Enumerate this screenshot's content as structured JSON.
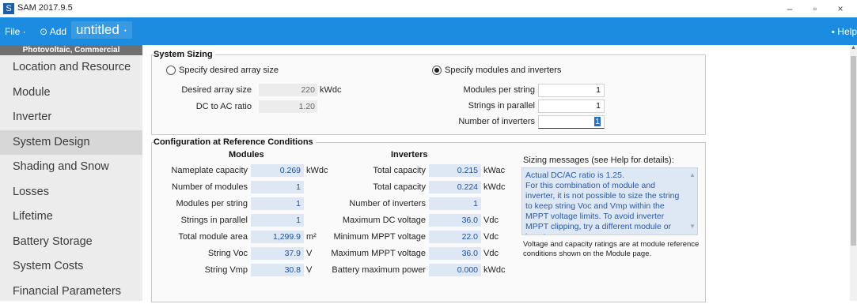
{
  "app": {
    "title": "SAM 2017.9.5",
    "icon": "S",
    "window_controls": [
      "–",
      "▫",
      "×"
    ]
  },
  "menu": {
    "file": "File ·",
    "add": "⊙ Add",
    "project": "untitled ·",
    "help": "▪ Help"
  },
  "sidebar": {
    "header": "Photovoltaic, Commercial",
    "items": [
      {
        "label": "Location and Resource"
      },
      {
        "label": "Module"
      },
      {
        "label": "Inverter"
      },
      {
        "label": "System Design"
      },
      {
        "label": "Shading and Snow"
      },
      {
        "label": "Losses"
      },
      {
        "label": "Lifetime"
      },
      {
        "label": "Battery Storage"
      },
      {
        "label": "System Costs"
      },
      {
        "label": "Financial Parameters"
      }
    ],
    "active_index": 3
  },
  "sizing": {
    "title": "System Sizing",
    "option_array": "Specify desired array size",
    "option_modules": "Specify modules and inverters",
    "selected": "Specify modules and inverters",
    "desired_array_size_label": "Desired array size",
    "desired_array_size_value": "220",
    "desired_array_size_unit": "kWdc",
    "dc_ac_ratio_label": "DC to AC ratio",
    "dc_ac_ratio_value": "1.20",
    "modules_per_string_label": "Modules per string",
    "modules_per_string_value": "1",
    "strings_in_parallel_label": "Strings in parallel",
    "strings_in_parallel_value": "1",
    "number_of_inverters_label": "Number of inverters",
    "number_of_inverters_value": "1"
  },
  "config": {
    "title": "Configuration at Reference Conditions",
    "modules_heading": "Modules",
    "inverters_heading": "Inverters",
    "modules": [
      {
        "label": "Nameplate capacity",
        "value": "0.269",
        "unit": "kWdc"
      },
      {
        "label": "Number of modules",
        "value": "1",
        "unit": ""
      },
      {
        "label": "Modules per string",
        "value": "1",
        "unit": ""
      },
      {
        "label": "Strings in parallel",
        "value": "1",
        "unit": ""
      },
      {
        "label": "Total module area",
        "value": "1,299.9",
        "unit": "m²"
      },
      {
        "label": "String Voc",
        "value": "37.9",
        "unit": "V"
      },
      {
        "label": "String Vmp",
        "value": "30.8",
        "unit": "V"
      }
    ],
    "inverters": [
      {
        "label": "Total capacity",
        "value": "0.215",
        "unit": "kWac"
      },
      {
        "label": "Total capacity",
        "value": "0.224",
        "unit": "kWdc"
      },
      {
        "label": "Number of inverters",
        "value": "1",
        "unit": ""
      },
      {
        "label": "Maximum DC voltage",
        "value": "36.0",
        "unit": "Vdc"
      },
      {
        "label": "Minimum MPPT voltage",
        "value": "22.0",
        "unit": "Vdc"
      },
      {
        "label": "Maximum MPPT voltage",
        "value": "36.0",
        "unit": "Vdc"
      },
      {
        "label": "Battery maximum power",
        "value": "0.000",
        "unit": "kWdc"
      }
    ],
    "messages_label": "Sizing messages (see Help for details):",
    "messages_text": "Actual DC/AC ratio is 1.25.\nFor this combination of module and inverter, it is not possible to size the string to keep string Voc and Vmp within the MPPT voltage limits. To avoid inverter MPPT clipping, try a different module or inverter.",
    "note": "Voltage and capacity ratings are at module reference conditions shown on the Module page."
  },
  "colors": {
    "menubar": "#1c8ce0",
    "sidebar_header": "#6f6f6f",
    "value_blue_bg": "#dde8f4",
    "value_blue_text": "#1f4f9c"
  }
}
